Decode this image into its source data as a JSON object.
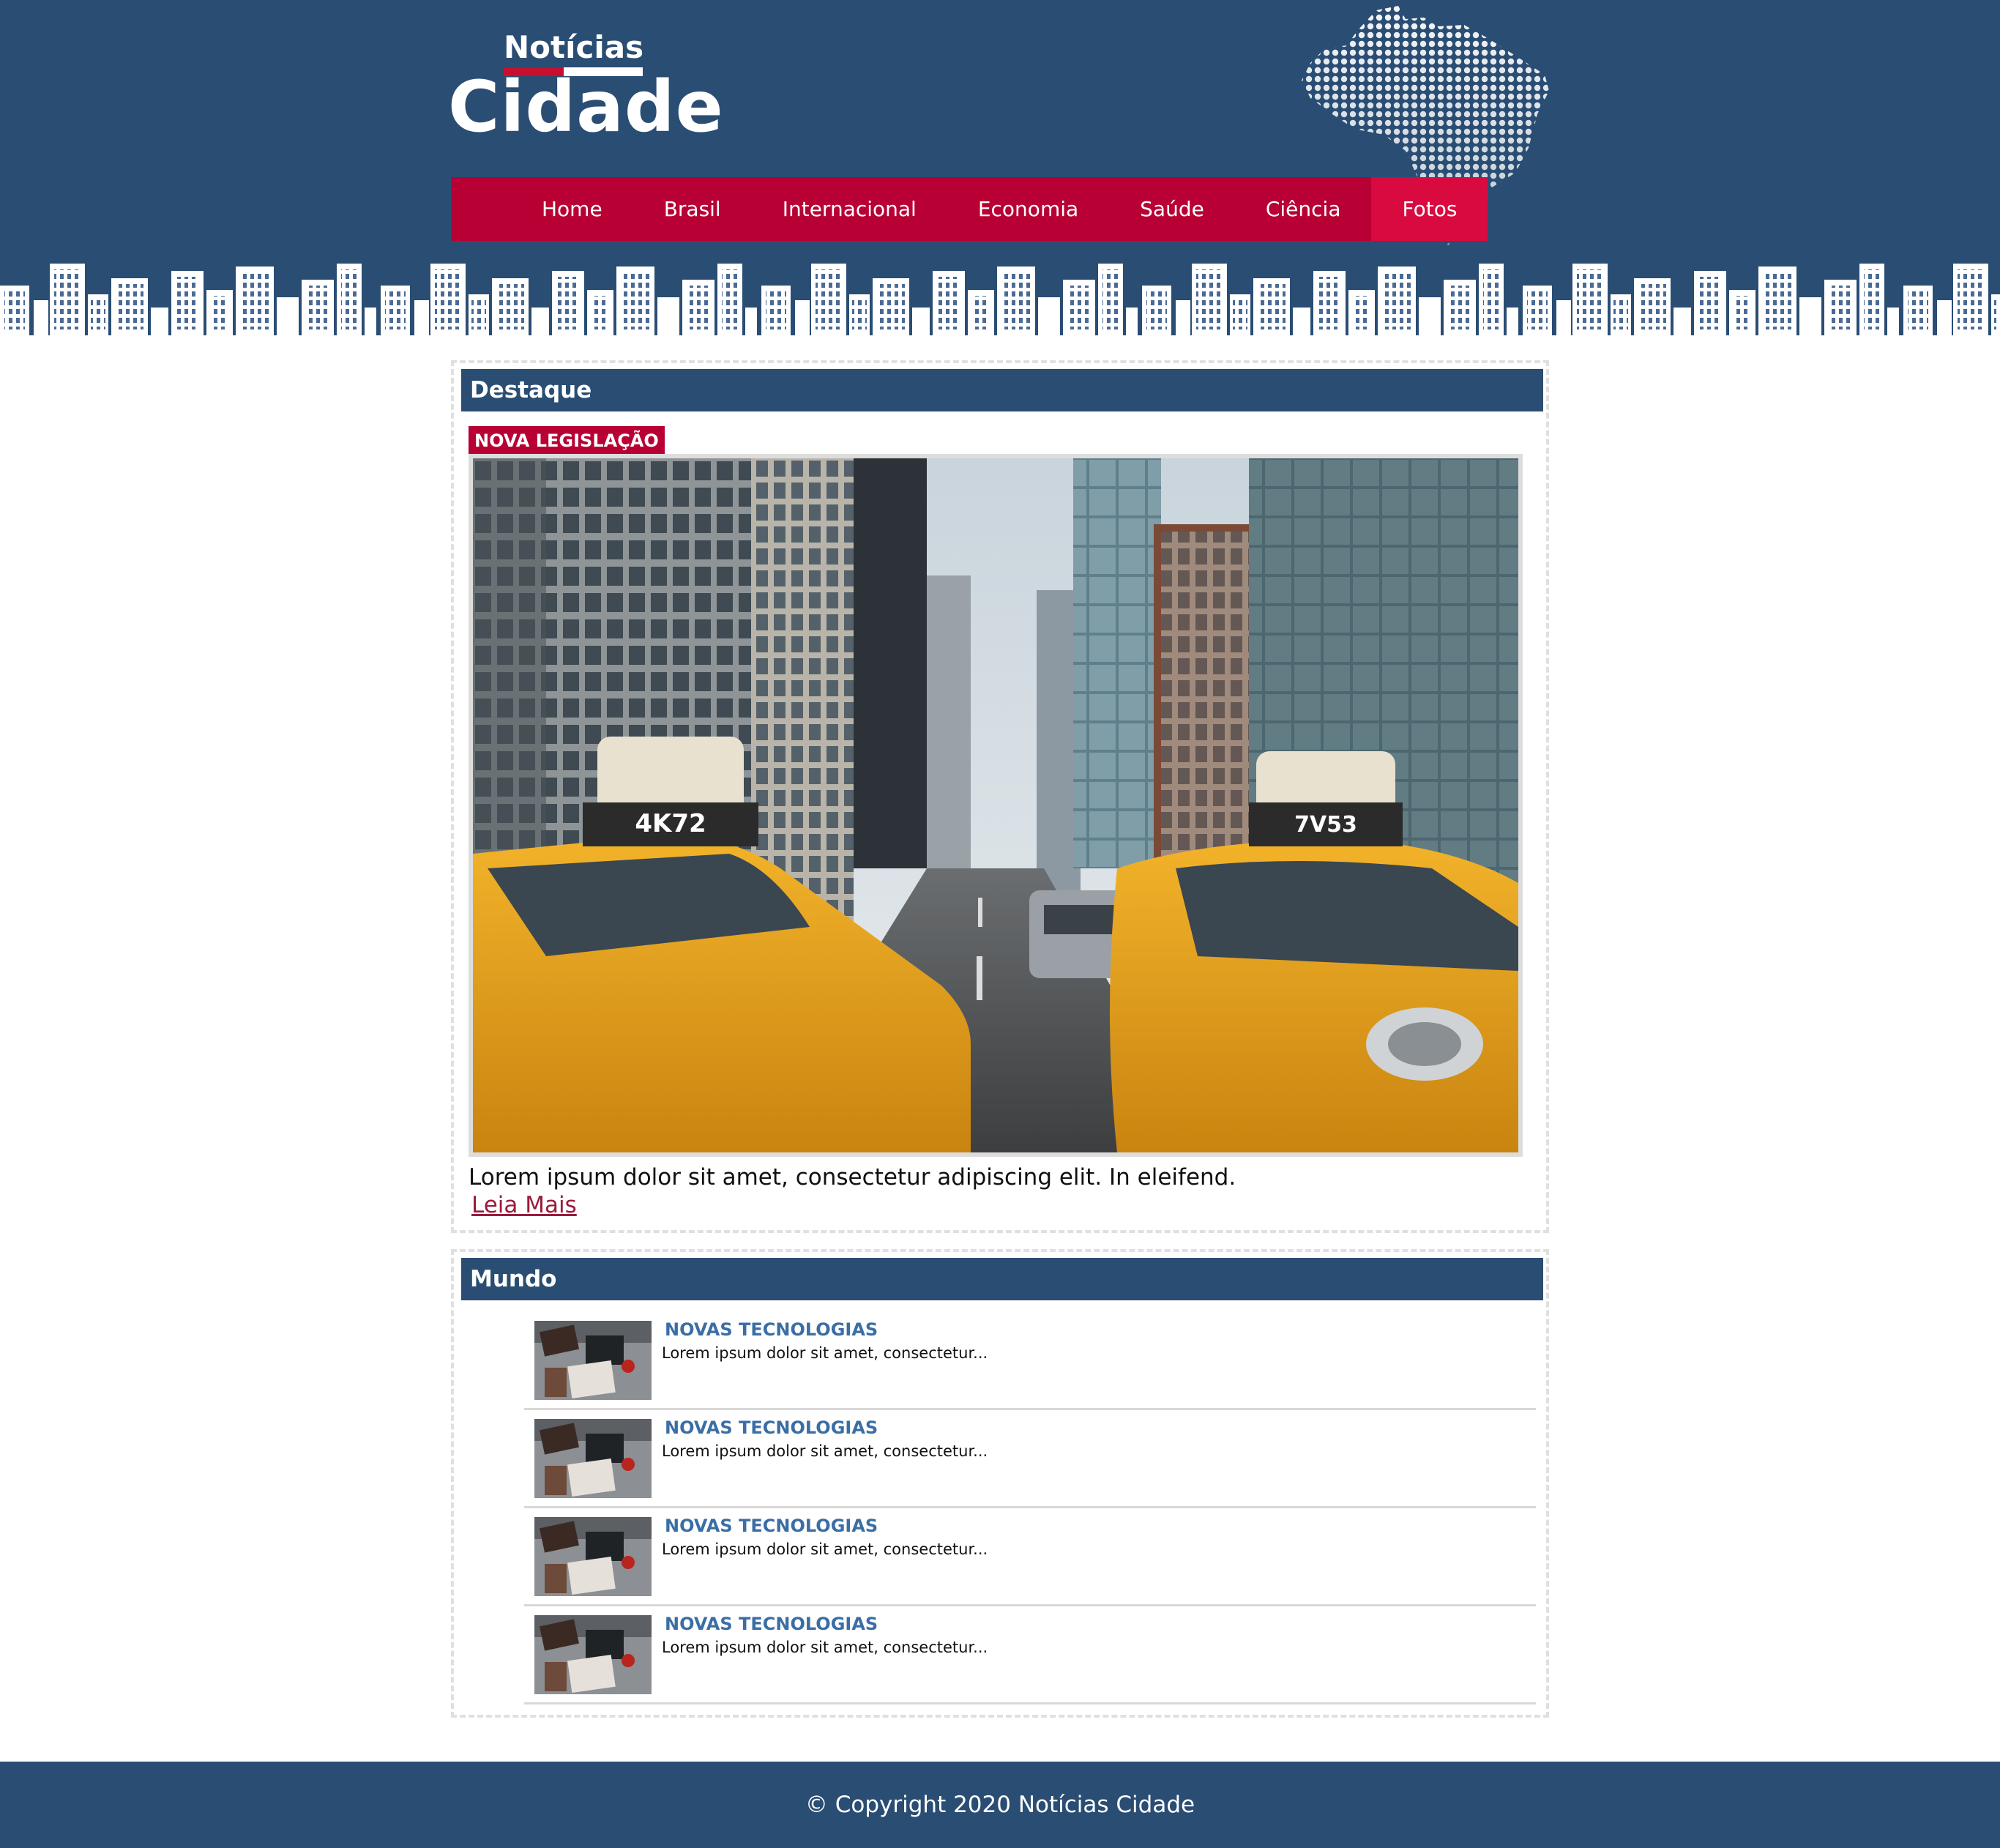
{
  "brand": {
    "line1": "Notícias",
    "line2": "Cidade"
  },
  "nav": {
    "items": [
      {
        "label": "Home"
      },
      {
        "label": "Brasil"
      },
      {
        "label": "Internacional"
      },
      {
        "label": "Economia"
      },
      {
        "label": "Saúde"
      },
      {
        "label": "Ciência"
      },
      {
        "label": "Fotos",
        "active": true
      }
    ]
  },
  "destaque": {
    "title": "Destaque",
    "tag": "NOVA LEGISLAÇÃO",
    "taxi_left_plate": "4K72",
    "taxi_right_plate": "7V53",
    "text": "Lorem ipsum dolor sit amet, consectetur adipiscing elit. In eleifend.",
    "read_more": "Leia Mais"
  },
  "mundo": {
    "title": "Mundo",
    "items": [
      {
        "title": "NOVAS TECNOLOGIAS",
        "text": "Lorem ipsum dolor sit amet, consectetur..."
      },
      {
        "title": "NOVAS TECNOLOGIAS",
        "text": "Lorem ipsum dolor sit amet, consectetur..."
      },
      {
        "title": "NOVAS TECNOLOGIAS",
        "text": "Lorem ipsum dolor sit amet, consectetur..."
      },
      {
        "title": "NOVAS TECNOLOGIAS",
        "text": "Lorem ipsum dolor sit amet, consectetur..."
      }
    ]
  },
  "footer": {
    "text": "© Copyright 2020 Notícias Cidade"
  },
  "colors": {
    "primary": "#2a4d73",
    "accent": "#b80034",
    "accent_active": "#d90a40",
    "link": "#3a6ea5"
  }
}
